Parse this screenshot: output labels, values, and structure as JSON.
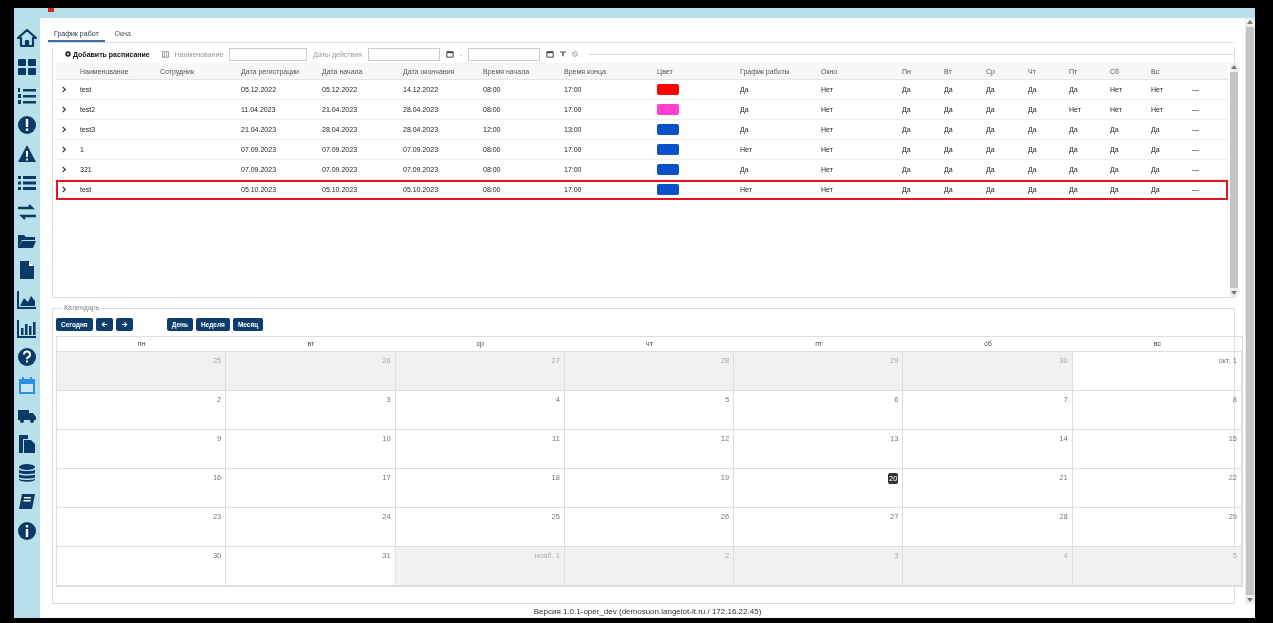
{
  "sidebar": {
    "items": [
      {
        "selected": false
      },
      {
        "selected": false
      },
      {
        "selected": false
      },
      {
        "selected": false
      },
      {
        "selected": false
      },
      {
        "selected": false
      },
      {
        "selected": false
      },
      {
        "selected": false
      },
      {
        "selected": false
      },
      {
        "selected": false
      },
      {
        "selected": false
      },
      {
        "selected": false
      },
      {
        "selected": true
      },
      {
        "selected": false
      },
      {
        "selected": false
      },
      {
        "selected": false
      },
      {
        "selected": false
      },
      {
        "selected": false
      }
    ]
  },
  "tabs": [
    {
      "label": "График работ",
      "selected": true
    },
    {
      "label": "Окна",
      "selected": false
    }
  ],
  "toolbar": {
    "add_button": "Добавить расписание",
    "name_label": "Наименование",
    "dates_label": "Даты действия",
    "dates_separator": "-"
  },
  "table": {
    "columns": [
      "Наименование",
      "Сотрудник",
      "Дата регистрации",
      "Дата начала",
      "Дата окончания",
      "Время начала",
      "Время конца",
      "Цвет",
      "График работы",
      "Окно",
      "Пн",
      "Вт",
      "Ср",
      "Чт",
      "Пт",
      "Сб",
      "Вс"
    ],
    "rows": [
      {
        "name": "test",
        "registered": "05.12.2022",
        "start": "05.12.2022",
        "end": "14.12.2022",
        "time_start": "08:00",
        "time_end": "17:00",
        "color": "#ff0000",
        "schedule": "Да",
        "window": "Нет",
        "days": [
          "Да",
          "Да",
          "Да",
          "Да",
          "Да",
          "Нет",
          "Нет"
        ],
        "action": "—",
        "highlighted": false
      },
      {
        "name": "test2",
        "registered": "11.04.2023",
        "start": "21.04.2023",
        "end": "28.04.2023",
        "time_start": "08:00",
        "time_end": "17:00",
        "color": "#ff3fcf",
        "schedule": "Да",
        "window": "Нет",
        "days": [
          "Да",
          "Да",
          "Да",
          "Да",
          "Нет",
          "Нет",
          "Нет"
        ],
        "action": "—",
        "highlighted": false
      },
      {
        "name": "test3",
        "registered": "21.04.2023",
        "start": "28.04.2023",
        "end": "28.04.2023",
        "time_start": "12:00",
        "time_end": "13:00",
        "color": "#0a50c8",
        "schedule": "Да",
        "window": "Нет",
        "days": [
          "Да",
          "Да",
          "Да",
          "Да",
          "Да",
          "Да",
          "Да"
        ],
        "action": "—",
        "highlighted": false
      },
      {
        "name": "1",
        "registered": "07.09.2023",
        "start": "07.09.2023",
        "end": "07.09.2023",
        "time_start": "08:00",
        "time_end": "17:00",
        "color": "#0a50c8",
        "schedule": "Нет",
        "window": "Нет",
        "days": [
          "Да",
          "Да",
          "Да",
          "Да",
          "Да",
          "Да",
          "Да"
        ],
        "action": "—",
        "highlighted": false
      },
      {
        "name": "321",
        "registered": "07.09.2023",
        "start": "07.09.2023",
        "end": "07.09.2023",
        "time_start": "08:00",
        "time_end": "17:00",
        "color": "#0a50c8",
        "schedule": "Да",
        "window": "Нет",
        "days": [
          "Да",
          "Да",
          "Да",
          "Да",
          "Да",
          "Да",
          "Да"
        ],
        "action": "—",
        "highlighted": false
      },
      {
        "name": "test",
        "registered": "05.10.2023",
        "start": "05.10.2023",
        "end": "05.10.2023",
        "time_start": "08:00",
        "time_end": "17:00",
        "color": "#0a50c8",
        "schedule": "Нет",
        "window": "Нет",
        "days": [
          "Да",
          "Да",
          "Да",
          "Да",
          "Да",
          "Да",
          "Да"
        ],
        "action": "—",
        "highlighted": true
      }
    ]
  },
  "calendar": {
    "legend": "Календарь",
    "today_button": "Сегодня",
    "views": [
      "День",
      "Неделя",
      "Месяц"
    ],
    "weekdays": [
      "пн",
      "вт",
      "ср",
      "чт",
      "пт",
      "сб",
      "вс"
    ],
    "weeks": [
      [
        {
          "day": "25",
          "other_month": true,
          "today": false
        },
        {
          "day": "26",
          "other_month": true,
          "today": false
        },
        {
          "day": "27",
          "other_month": true,
          "today": false
        },
        {
          "day": "28",
          "other_month": true,
          "today": false
        },
        {
          "day": "29",
          "other_month": true,
          "today": false
        },
        {
          "day": "30",
          "other_month": true,
          "today": false
        },
        {
          "day": "окт. 1",
          "other_month": false,
          "today": false
        }
      ],
      [
        {
          "day": "2",
          "other_month": false,
          "today": false
        },
        {
          "day": "3",
          "other_month": false,
          "today": false
        },
        {
          "day": "4",
          "other_month": false,
          "today": false
        },
        {
          "day": "5",
          "other_month": false,
          "today": false
        },
        {
          "day": "6",
          "other_month": false,
          "today": false
        },
        {
          "day": "7",
          "other_month": false,
          "today": false
        },
        {
          "day": "8",
          "other_month": false,
          "today": false
        }
      ],
      [
        {
          "day": "9",
          "other_month": false,
          "today": false
        },
        {
          "day": "10",
          "other_month": false,
          "today": false
        },
        {
          "day": "11",
          "other_month": false,
          "today": false
        },
        {
          "day": "12",
          "other_month": false,
          "today": false
        },
        {
          "day": "13",
          "other_month": false,
          "today": false
        },
        {
          "day": "14",
          "other_month": false,
          "today": false
        },
        {
          "day": "15",
          "other_month": false,
          "today": false
        }
      ],
      [
        {
          "day": "16",
          "other_month": false,
          "today": false
        },
        {
          "day": "17",
          "other_month": false,
          "today": false
        },
        {
          "day": "18",
          "other_month": false,
          "today": false
        },
        {
          "day": "19",
          "other_month": false,
          "today": false
        },
        {
          "day": "20",
          "other_month": false,
          "today": true
        },
        {
          "day": "21",
          "other_month": false,
          "today": false
        },
        {
          "day": "22",
          "other_month": false,
          "today": false
        }
      ],
      [
        {
          "day": "23",
          "other_month": false,
          "today": false
        },
        {
          "day": "24",
          "other_month": false,
          "today": false
        },
        {
          "day": "25",
          "other_month": false,
          "today": false
        },
        {
          "day": "26",
          "other_month": false,
          "today": false
        },
        {
          "day": "27",
          "other_month": false,
          "today": false
        },
        {
          "day": "28",
          "other_month": false,
          "today": false
        },
        {
          "day": "29",
          "other_month": false,
          "today": false
        }
      ],
      [
        {
          "day": "30",
          "other_month": false,
          "today": false
        },
        {
          "day": "31",
          "other_month": false,
          "today": false
        },
        {
          "day": "нояб. 1",
          "other_month": true,
          "today": false
        },
        {
          "day": "2",
          "other_month": true,
          "today": false
        },
        {
          "day": "3",
          "other_month": true,
          "today": false
        },
        {
          "day": "4",
          "other_month": true,
          "today": false
        },
        {
          "day": "5",
          "other_month": true,
          "today": false
        }
      ]
    ]
  },
  "footer": "Версия 1.0.1-oper_dev (demosuon.langelot-it.ru / 172.16.22.45)"
}
